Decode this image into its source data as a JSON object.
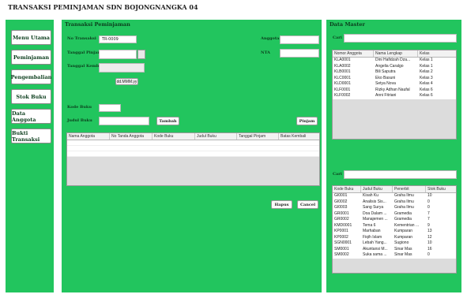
{
  "app": {
    "title": "TRANSAKSI PEMINJAMAN SDN BOJONGNANGKA 04"
  },
  "sidebar": {
    "items": [
      {
        "label": "Menu Utama"
      },
      {
        "label": "Peminjaman"
      },
      {
        "label": "Pengembalian"
      },
      {
        "label": "Stok Buku"
      },
      {
        "label": "Data Anggota"
      },
      {
        "label": "Bukti Transaksi"
      }
    ]
  },
  "transaksi": {
    "title": "Transaksi Peminjaman",
    "no_transaksi_label": "No Transaksi",
    "no_transaksi_value": "TR-0009",
    "tanggal_pinjam_label": "Tanggal Pinjam",
    "tanggal_kembali_label": "Tanggal Kembali",
    "date_format": "dd.MMM.yy",
    "anggota_label": "Anggota",
    "nta_label": "NTA",
    "kode_buku_label": "Kode Buku",
    "judul_buku_label": "Judul Buku",
    "tambah_label": "Tambah",
    "pinjam_label": "Pinjam",
    "hapus_label": "Hapus",
    "cancel_label": "Cancel",
    "table_headers": [
      "Nama Anggota",
      "No Tanda Anggota",
      "Kode Buku",
      "Judul Buku",
      "Tanggal Pinjam",
      "Batas Kembali"
    ]
  },
  "master": {
    "title": "Data Master",
    "cari_label": "Cari",
    "anggota_headers": [
      "Nomor Anggota",
      "Nama Lengkap",
      "Kelas"
    ],
    "anggota_rows": [
      [
        "KLA0001",
        "Dini Hafidzah Dza...",
        "Kelas 1"
      ],
      [
        "KLA0002",
        "Angelia Caralgo",
        "Kelas 1"
      ],
      [
        "KLB0001",
        "Bili Saputra",
        "Kelas 2"
      ],
      [
        "KLC0001",
        "Eko Basuni",
        "Kelas 3"
      ],
      [
        "KLD0001",
        "Setya Nova",
        "Kelas 4"
      ],
      [
        "KLF0001",
        "Rizky Adhan Naufal",
        "Kelas 6"
      ],
      [
        "KLF0002",
        "Anni Fitriani",
        "Kelas 6"
      ]
    ],
    "buku_headers": [
      "Kode Buku",
      "Judul Buku",
      "Penerbit",
      "Stok Buku"
    ],
    "buku_rows": [
      [
        "GI0001",
        "Kisah Ku",
        "Graha Ilmu",
        "10"
      ],
      [
        "GI0002",
        "Analisis Sis...",
        "Graha Ilmu",
        "0"
      ],
      [
        "GI0003",
        "Sang Surya",
        "Graha Ilmu",
        "0"
      ],
      [
        "GR0001",
        "Doa Dalam ...",
        "Gramedia",
        "7"
      ],
      [
        "GR0002",
        "Manajemen ...",
        "Gramedia",
        "7"
      ],
      [
        "KMD0001",
        "Tema 6",
        "Kementrian ...",
        "9"
      ],
      [
        "KP0001",
        "Marhaban",
        "Kumparan",
        "13"
      ],
      [
        "KP0002",
        "Fiqih Islam",
        "Kumparan",
        "12"
      ],
      [
        "SGN0001",
        "Lebah Yang...",
        "Sugiono",
        "10"
      ],
      [
        "SM0001",
        "Akuntansi M...",
        "Sinar Mas",
        "16"
      ],
      [
        "SM0002",
        "Suka sama ...",
        "Sinar Mas",
        "0"
      ]
    ]
  }
}
